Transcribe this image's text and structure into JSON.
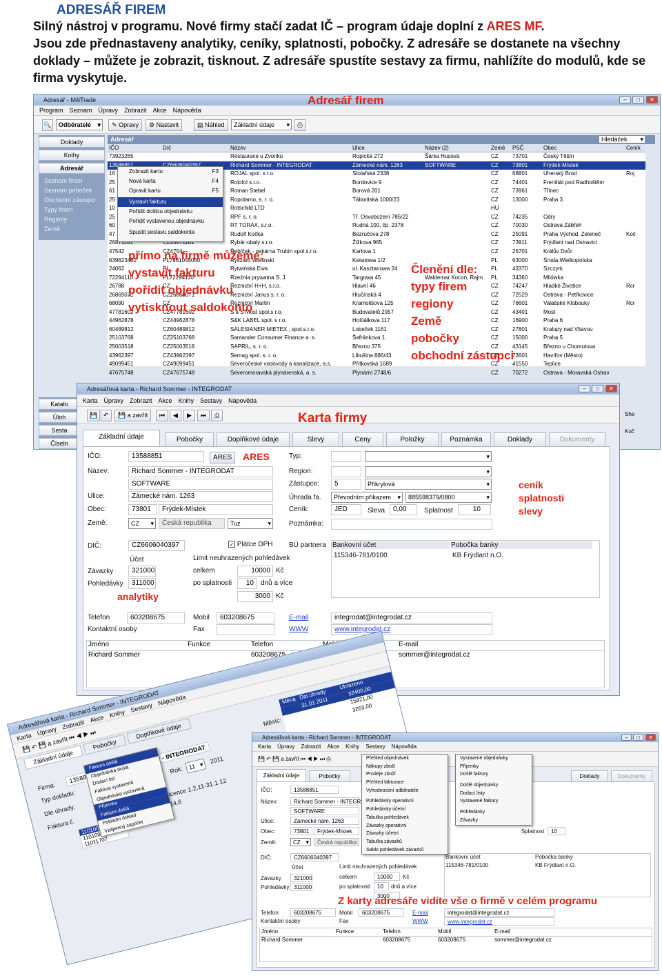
{
  "header": {
    "title": "ADRESÁŘ FIREM",
    "line1_a": "Silný nástroj v programu. Nové firmy stačí zadat IČ – program údaje doplní z ",
    "line1_b": "ARES MF",
    "line1_c": ".",
    "line2": "Jsou zde přednastaveny analytiky, ceníky, splatnosti, pobočky. Z adresáře se dostanete na všechny",
    "line3": "doklady – můžete je zobrazit, tisknout. Z adresáře spustíte sestavy za firmu, nahlížíte do modulů, kde se",
    "line4": "firma vyskytuje."
  },
  "annotations": {
    "adresar_firem": "Adresář firem",
    "primo": "přímo na firmě můžeme:",
    "vystavit": "vystavit fakturu",
    "poridit": "pořídit objednávku",
    "vytisknout": "vytisknout saldokonto",
    "cleneni": "Členění dle:",
    "typy": "typy firem",
    "regiony": "regiony",
    "zeme": "Země",
    "pobocky": "pobočky",
    "zastupci": "obchodní zástupci",
    "karta_firmy": "Karta firmy",
    "ares": "ARES",
    "cenik": "ceník",
    "splatnosti": "splatnosti",
    "slevy": "slevy",
    "analytiky": "analytiky",
    "z_karty": "Z karty adresáře vidíte vše o firmě v celém programu"
  },
  "w1": {
    "title": "Adresář - MiliTrade",
    "menu": [
      "Program",
      "Seznam",
      "Úpravy",
      "Zobrazit",
      "Akce",
      "Nápověda"
    ],
    "filter": "Odběratelé",
    "opravy": "Opravy",
    "nastavit": "Nastavit",
    "nahled": "Náhled",
    "view": "Základní údaje",
    "grid_title": "Adresář",
    "search": "Hledáček",
    "side_buttons": [
      "Doklady",
      "Knihy",
      "Adresář"
    ],
    "side_links": [
      "Seznam firem",
      "Seznam poboček",
      "Obchodní zástupci",
      "Typy firem",
      "Regiony",
      "Země"
    ],
    "side_bottom": [
      "Katalo",
      "Úloh",
      "Sesta",
      "Číseln"
    ],
    "cols": [
      "IČO",
      "Díč",
      "Název",
      "Ulice",
      "Název (2)",
      "Země",
      "PSČ",
      "Obec",
      "Ceník"
    ],
    "rows": [
      [
        "73923265",
        "",
        "Restaurace u Zvonku",
        "Ropická 272",
        "Šárka Husová",
        "CZ",
        "73701",
        "Český Těšín",
        ""
      ],
      [
        "13588851",
        "CZ6606040397",
        "Richard Sommer - INTEGRODAT",
        "Zámecké nám. 1263",
        "SOFTWARE",
        "CZ",
        "73801",
        "Frýdek-Místek",
        ""
      ],
      [
        "16",
        "",
        "ROJAL spol. s r.o.",
        "Stolařská 2338",
        "",
        "CZ",
        "68801",
        "Uherský Brod",
        "Roj"
      ],
      [
        "25",
        "",
        "Rolofol s.r.o.",
        "Bordovice 9",
        "",
        "CZ",
        "74401",
        "Frenštát pod Radhoštěm",
        ""
      ],
      [
        "61",
        "",
        "Roman Stebel",
        "Borová 201",
        "",
        "CZ",
        "73961",
        "Třinec",
        ""
      ],
      [
        "25",
        "",
        "Ropotamo, s. r. o.",
        "Táboritská 1000/23",
        "",
        "CZ",
        "13000",
        "Praha 3",
        ""
      ],
      [
        "10",
        "",
        "Rotschild LTD",
        "",
        "",
        "HU",
        "",
        "",
        ""
      ],
      [
        "25",
        "",
        "RPF s. r. o.",
        "Tř. Osvobození 785/22",
        "",
        "CZ",
        "74235",
        "Odry",
        ""
      ],
      [
        "60",
        "",
        "RT TORAX, s.r.o.",
        "Rudná 100, čp. 2378",
        "",
        "CZ",
        "70030",
        "Ostrava Zábřeh",
        ""
      ],
      [
        "47",
        "",
        "Rudolf Kočka",
        "Bezručova 278",
        "",
        "CZ",
        "25091",
        "Praha Východ, Zeleneč",
        "Koč"
      ],
      [
        "26871181",
        "CZ26871181",
        "Rybár-obaly s.r.o.",
        "Žižkova 965",
        "",
        "CZ",
        "73911",
        "Frýdlant nad Ostravicí",
        ""
      ],
      [
        "47542",
        "CZ4754",
        "Řebíček - pekárna Trubín spol.s.r.o.",
        "Karlova 1",
        "",
        "CZ",
        "26701",
        "Králův Dvůr",
        ""
      ],
      [
        "639623462",
        "PL7861045060",
        "Ryszard Wielinski",
        "Kwiatowa 1/2",
        "",
        "PL",
        "63000",
        "Środa Wielkopolska",
        ""
      ],
      [
        "24062",
        "PL",
        "Rytwińska Ewa",
        "ul. Kasztanowa 24",
        "",
        "PL",
        "43370",
        "Szczyrk",
        ""
      ],
      [
        "72294110",
        "PL72294110",
        "Rzeźnia prywatna S. J.",
        "Targowa 45",
        "Waldemar Kocoń, Rajm",
        "PL",
        "34360",
        "Milówka",
        ""
      ],
      [
        "26788",
        "CZ",
        "Řeznictví H+H, s.r.o.",
        "Hlavní 46",
        "",
        "CZ",
        "74247",
        "Hladké Životice",
        "Rcr"
      ],
      [
        "26869071",
        "CZ26869071",
        "Řeznictví Janus s. r. o.",
        "Hlučínská 4",
        "",
        "CZ",
        "72529",
        "Ostrava - Petřkovice",
        ""
      ],
      [
        "68090",
        "CZ",
        "Řeznictví Martin",
        "Kramolišova 125",
        "",
        "CZ",
        "76601",
        "Valašské Klobouky",
        "Rcr"
      ],
      [
        "47781602",
        "CZ47781602",
        "S a S Most spol.s r.o.",
        "Budovatelů 2957",
        "",
        "CZ",
        "43401",
        "Most",
        ""
      ],
      [
        "44962878",
        "CZ44962878",
        "S&K LABEL spol. s r.o.",
        "Hoštálkova 117",
        "",
        "CZ",
        "16900",
        "Praha 6",
        ""
      ],
      [
        "60489812",
        "CZ60489812",
        "SALESIANER MIETEX , spol.s.r.o.",
        "Lobeček 1161",
        "",
        "CZ",
        "27801",
        "Kralupy nad Vltavou",
        ""
      ],
      [
        "25103768",
        "CZ25103768",
        "Santander Consumer Finance a. s.",
        "Šafránkova 1",
        "",
        "CZ",
        "15000",
        "Praha 5",
        ""
      ],
      [
        "25003518",
        "CZ25003518",
        "SAPRIL, s. r. o.",
        "Březno 375",
        "",
        "CZ",
        "43145",
        "Březno u Chomutova",
        ""
      ],
      [
        "43962397",
        "CZ43962397",
        "Semag spol. s. r. o.",
        "Libušina 886/43",
        "",
        "CZ",
        "73601",
        "Havířov (Město)",
        ""
      ],
      [
        "49099451",
        "CZ49099451",
        "Severočeské vodovody a kanalizace, a.s.",
        "Přítkovská 1689",
        "",
        "CZ",
        "41550",
        "Teplice",
        ""
      ],
      [
        "47675748",
        "CZ47675748",
        "Severomoravská plynárenská, a. s.",
        "Plynární 2748/6",
        "",
        "CZ",
        "70272",
        "Ostrava - Moravská Ostrav",
        ""
      ]
    ],
    "ctx": [
      [
        "Zobrazit kartu",
        "F3"
      ],
      [
        "Nová karta",
        "F4"
      ],
      [
        "Opravit kartu",
        "F5"
      ],
      [
        "Vystavit fakturu",
        ""
      ],
      [
        "Pořídit došlou objednávku",
        ""
      ],
      [
        "Pořídit vystavenou objednávku",
        ""
      ],
      [
        "Spustit sestavu saldokonta",
        ""
      ]
    ],
    "right_tail": [
      "She",
      "Koč"
    ]
  },
  "w2": {
    "title": "Adresářová karta - Richard Sommer - INTEGRODAT",
    "menu": [
      "Karta",
      "Úpravy",
      "Zobrazit",
      "Akce",
      "Knihy",
      "Sestavy",
      "Nápověda"
    ],
    "save": "a zavřít",
    "tabs": [
      "Základní údaje",
      "Pobočky",
      "Doplňkové údaje",
      "Slevy",
      "Ceny",
      "Položky",
      "Poznámka",
      "Doklady",
      "Dokumenty"
    ],
    "ico_lbl": "IČO:",
    "ico": "13588851",
    "ares_btn": "ARES",
    "nazev_lbl": "Název:",
    "nazev1": "Richard Sommer - INTEGRODAT",
    "nazev2": "SOFTWARE",
    "ulice_lbl": "Ulice:",
    "ulice": "Zámecké nám. 1263",
    "obec_lbl": "Obec:",
    "psc": "73801",
    "obec": "Frýdek-Místek",
    "zeme_lbl": "Země:",
    "zeme": "CZ",
    "zeme_name": "Česká republika",
    "tuz": "Tuz",
    "typ_lbl": "Typ:",
    "region_lbl": "Region:",
    "zastupce_lbl": "Zástupce:",
    "zastupce_no": "5",
    "zastupce": "Přikrylová",
    "uhrada_lbl": "Úhrada fa.",
    "uhrada": "Převodním příkazem",
    "ucet": "885598379/0800",
    "cenik_lbl": "Ceník:",
    "cenik": "JED",
    "sleva_lbl": "Sleva",
    "sleva": "0,00",
    "splatnost_lbl": "Splatnost",
    "splatnost": "10",
    "poznamka_lbl": "Poznámka:",
    "dic_lbl": "DIČ:",
    "dic": "CZ6606040397",
    "platce": "Plátce DPH",
    "ucet_hdr": "Účet",
    "limit_hdr": "Limit neuhrazených pohledávek",
    "zavazky_lbl": "Závazky",
    "zavazky": "321000",
    "pohledavky_lbl": "Pohledávky",
    "pohledavky": "311000",
    "celkem_lbl": "celkem",
    "celkem": "10000",
    "kc": "Kč",
    "posplat_lbl": "po splatnosti",
    "posplat_dni": "10",
    "dnu": "dnů a více",
    "posplat": "3000",
    "bu_lbl": "BÚ partnera",
    "bu_hdr1": "Bankovní účet",
    "bu_hdr2": "Pobočka banky",
    "bu1": "115346-781/0100",
    "bu2": "KB Frýdlant n.O.",
    "tel_lbl": "Telefon",
    "tel": "603208675",
    "mob_lbl": "Mobil",
    "mob": "603208675",
    "fax_lbl": "Fax",
    "email_lbl": "E-mail",
    "email": "integrodat@integrodat.cz",
    "www_lbl": "WWW",
    "www": "www.integrodat.cz",
    "kontakt_lbl": "Kontaktní osoby",
    "ct_cols": [
      "Jméno",
      "Funkce",
      "Telefon",
      "Mobil",
      "E-mail"
    ],
    "ct_row": [
      "Richard Sommer",
      "",
      "603208675",
      "603208675",
      "sommer@integrodat.cz"
    ]
  },
  "w3": {
    "title": "Adresářová karta - Richard Sommer - INTEGRODAT",
    "menu": [
      "Karta",
      "Úpravy",
      "Zobrazit",
      "Akce",
      "Knihy",
      "Sestavy",
      "Nápověda"
    ],
    "firma_lbl": "Firma:",
    "firma": "13588851",
    "typ": "Typ dokladu:",
    "dle": "Dle úhrady:",
    "faktura": "Faktura č.",
    "rok_lbl": "Rok:",
    "rok": "2011",
    "mesic": "Měsíc:",
    "cislo": "Číslo",
    "menu_items": [
      "Faktura došlá",
      "Objednávka došlá",
      "Dodací list",
      "Faktura vystavená",
      "Objednávka vystavená",
      "Příjemka",
      "Faktura došlá",
      "Pokladní doklad",
      "Vzájemný zápočet"
    ],
    "list": [
      "11010067",
      "11010813",
      "11011707"
    ],
    "lic": "licence 1.2.11-31.1.12",
    "sub": "14.6",
    "money_hdr": [
      "Měna",
      "Dat.úhrady",
      "Uhrazeno"
    ],
    "money": [
      "32400,00",
      "15821,00",
      "3263,00"
    ],
    "date": "31.01.2011"
  },
  "w4": {
    "title": "Adresářová karta - Richard Sommer - INTEGRODAT",
    "menu": [
      "Karta",
      "Úpravy",
      "Zobrazit",
      "Akce",
      "Knihy",
      "Sestavy",
      "Nápověda"
    ],
    "tabs": [
      "Základní údaje",
      "Pobočky",
      "Doklady",
      "Dokumenty"
    ],
    "sestavy": [
      "Přehled objednávek",
      "Nákupy zboží",
      "Prodeje zboží",
      "Přehled fakturace",
      "Vyhodnocení odběratele",
      "Pohledávky operativní",
      "Pohledávky účetní",
      "Tabulka pohledávek",
      "Závazky operativní",
      "Závazky účetní",
      "Tabulka závazků",
      "Saldo pohledávek závazků"
    ],
    "knihy": [
      "Vystavené objednávky",
      "Příjemky",
      "Došlé faktury",
      "Došlé objednávky",
      "Dodací listy",
      "Vystavené faktury",
      "Pohledávky",
      "Závazky"
    ],
    "ico_lbl": "IČO:",
    "ico": "13588851",
    "nazev_lbl": "Název:",
    "nazev": "Richard Sommer - INTEGR",
    "nazev2": "SOFTWARE",
    "ulice_lbl": "Ulice:",
    "ulice": "Zámecké nám. 1263",
    "obec_lbl": "Obec:",
    "psc": "73801",
    "obec": "Frýdek-Místek",
    "zeme_lbl": "Země:",
    "zeme": "CZ",
    "zeme_name": "Česká republika",
    "splatnost": "Splatnost",
    "spl": "10",
    "dic_lbl": "DIČ:",
    "dic": "CZ6606040397",
    "ucet": "Účet",
    "limit": "Limit neuhrazených pohledávek",
    "zav_lbl": "Závazky",
    "zav": "321000",
    "poh_lbl": "Pohledávky",
    "poh": "311000",
    "celkem_lbl": "celkem",
    "celkem": "10000",
    "kc": "Kč",
    "posp_lbl": "po splatnosti",
    "posp": "10",
    "dnu": "dnů a více",
    "posp2": "3000",
    "bu1_hdr": "Bankovní účet",
    "bu2_hdr": "Pobočka banky",
    "bu1": "115346-781/0100",
    "bu2": "KB Frýdlant n.O.",
    "tel_lbl": "Telefon",
    "tel": "603208675",
    "mob_lbl": "Mobil",
    "mob": "603208675",
    "email_lbl": "E-mail",
    "email": "integrodat@integrodat.cz",
    "kontakt_lbl": "Kontaktní osoby",
    "fax_lbl": "Fax",
    "www_lbl": "WWW",
    "www": "www.integrodat.cz",
    "ct_cols": [
      "Jméno",
      "Funkce",
      "Telefon",
      "Mobil",
      "E-mail"
    ],
    "ct_row": [
      "Richard Sommer",
      "",
      "603208675",
      "603208675",
      "sommer@integrodat.cz"
    ]
  }
}
